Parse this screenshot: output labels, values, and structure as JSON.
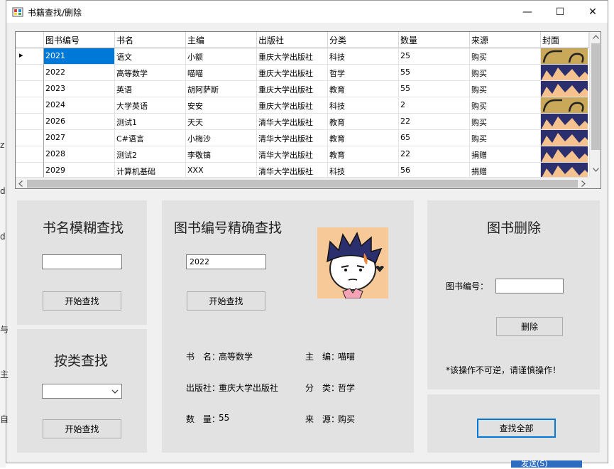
{
  "window": {
    "title": "书籍查找/删除",
    "minimize": "—",
    "maximize": "☐",
    "close": "✕"
  },
  "bg_left_chars": [
    "z",
    "d",
    "d",
    "与",
    "主",
    "自"
  ],
  "grid": {
    "headers": [
      "图书编号",
      "书名",
      "主编",
      "出版社",
      "分类",
      "数量",
      "来源",
      "封面"
    ],
    "rows": [
      {
        "id": "2021",
        "name": "语文",
        "editor": "小额",
        "publisher": "重庆大学出版社",
        "category": "科技",
        "qty": "25",
        "source": "购买",
        "cover": "a"
      },
      {
        "id": "2022",
        "name": "高等数学",
        "editor": "喵喵",
        "publisher": "重庆大学出版社",
        "category": "哲学",
        "qty": "55",
        "source": "购买",
        "cover": "b"
      },
      {
        "id": "2023",
        "name": "英语",
        "editor": "胡阿萨斯",
        "publisher": "重庆大学出版社",
        "category": "教育",
        "qty": "55",
        "source": "购买",
        "cover": "b"
      },
      {
        "id": "2024",
        "name": "大学英语",
        "editor": "安安",
        "publisher": "重庆大学出版社",
        "category": "科技",
        "qty": "2",
        "source": "购买",
        "cover": "a"
      },
      {
        "id": "2026",
        "name": "测试1",
        "editor": "天天",
        "publisher": "清华大学出版社",
        "category": "教育",
        "qty": "22",
        "source": "购买",
        "cover": "b"
      },
      {
        "id": "2027",
        "name": "C#语言",
        "editor": "小梅沙",
        "publisher": "清华大学出版社",
        "category": "教育",
        "qty": "65",
        "source": "购买",
        "cover": "b"
      },
      {
        "id": "2028",
        "name": "测试2",
        "editor": "李敬镐",
        "publisher": "清华大学出版社",
        "category": "教育",
        "qty": "22",
        "source": "捐赠",
        "cover": "b"
      },
      {
        "id": "2029",
        "name": "计算机基础",
        "editor": "XXX",
        "publisher": "清华大学出版社",
        "category": "科技",
        "qty": "56",
        "source": "捐赠",
        "cover": "b"
      }
    ],
    "selected_row": 0,
    "row_indicator": "▸"
  },
  "fuzzy": {
    "title": "书名模糊查找",
    "input": "",
    "button": "开始查找"
  },
  "category_search": {
    "title": "按类查找",
    "selected": "",
    "button": "开始查找"
  },
  "exact": {
    "title": "图书编号精确查找",
    "input": "2022",
    "button": "开始查找",
    "details": {
      "name_label": "书　名：",
      "name": "高等数学",
      "editor_label": "主　编：",
      "editor": "喵喵",
      "publisher_label": "出版社：",
      "publisher": "重庆大学出版社",
      "category_label": "分　类：",
      "category": "哲学",
      "qty_label": "数　量：",
      "qty": "55",
      "source_label": "来　源：",
      "source": "购买"
    }
  },
  "delete": {
    "title": "图书删除",
    "id_label": "图书编号：",
    "input": "",
    "button": "删除",
    "warning": "*该操作不可逆，请谨慎操作！"
  },
  "find_all": {
    "button": "查找全部"
  },
  "taskbar_peek": "发送(S)"
}
